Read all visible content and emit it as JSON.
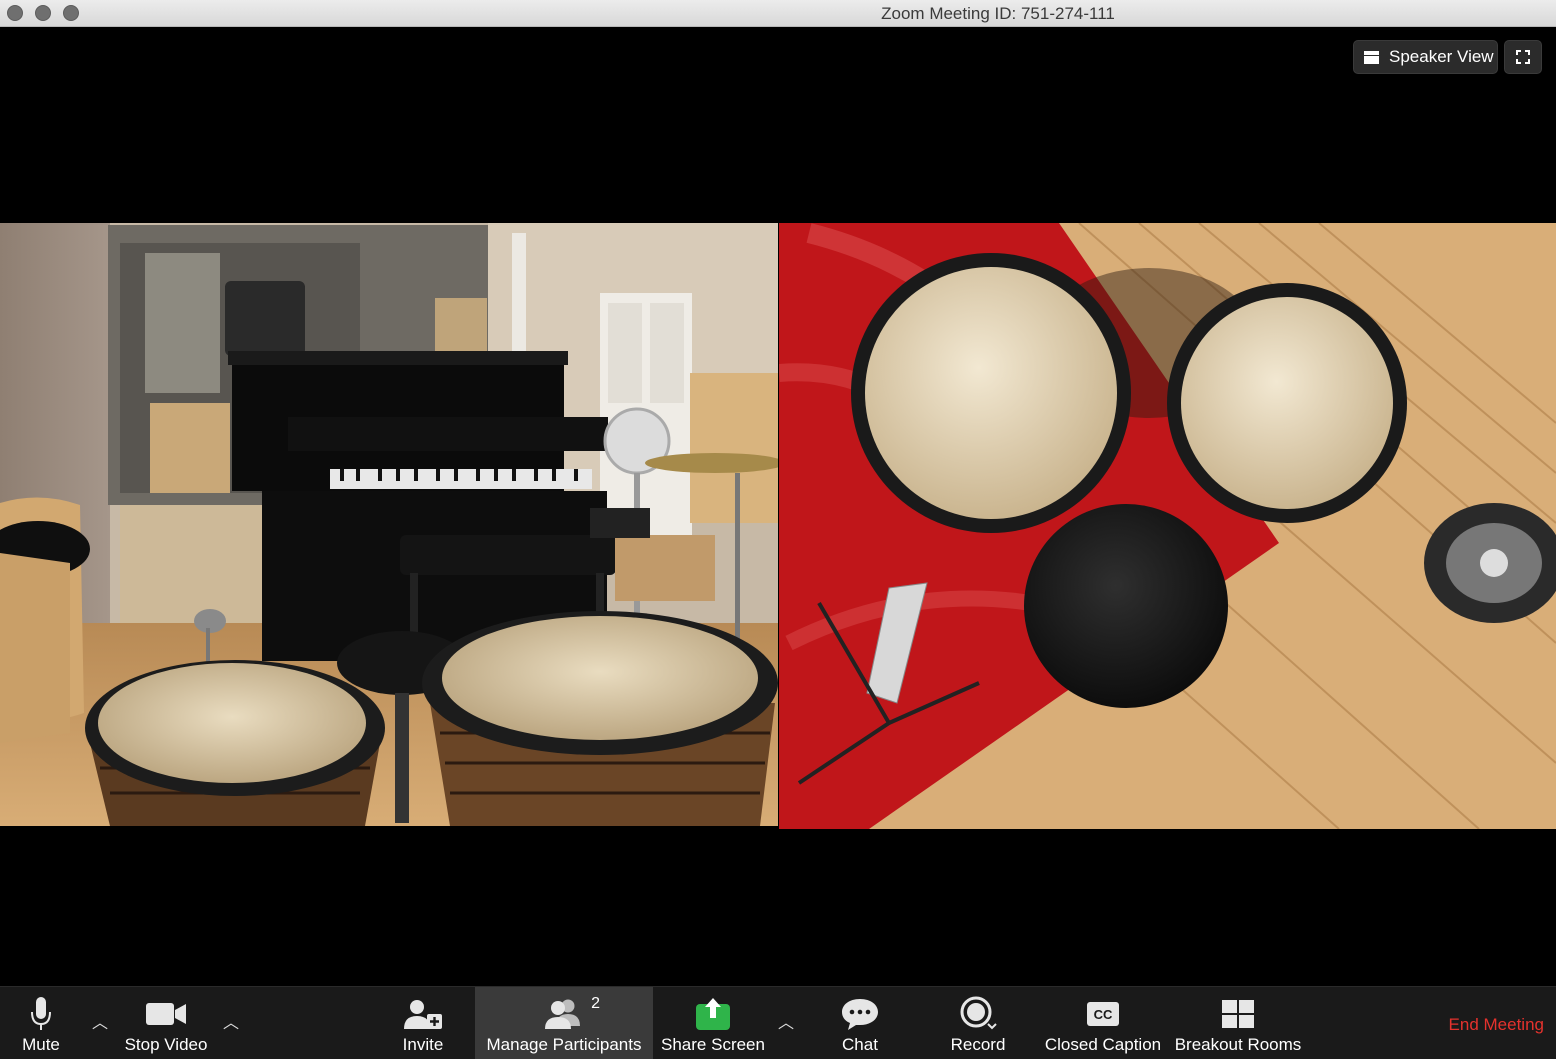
{
  "window": {
    "title": "Zoom Meeting ID: 751-274-111"
  },
  "stage": {
    "speaker_view_label": "Speaker View",
    "tiles": [
      {
        "scene": "studio-piano-djembes"
      },
      {
        "scene": "overhead-djembes-stool"
      }
    ]
  },
  "toolbar": {
    "mute": "Mute",
    "stop_video": "Stop Video",
    "invite": "Invite",
    "manage_participants": "Manage Participants",
    "participant_count": "2",
    "share_screen": "Share Screen",
    "chat": "Chat",
    "record": "Record",
    "closed_caption": "Closed Caption",
    "breakout_rooms": "Breakout Rooms",
    "end_meeting": "End Meeting"
  },
  "colors": {
    "share_green": "#2fb44a",
    "end_red": "#e5322d",
    "toolbar_bg": "#1a1a1a"
  }
}
